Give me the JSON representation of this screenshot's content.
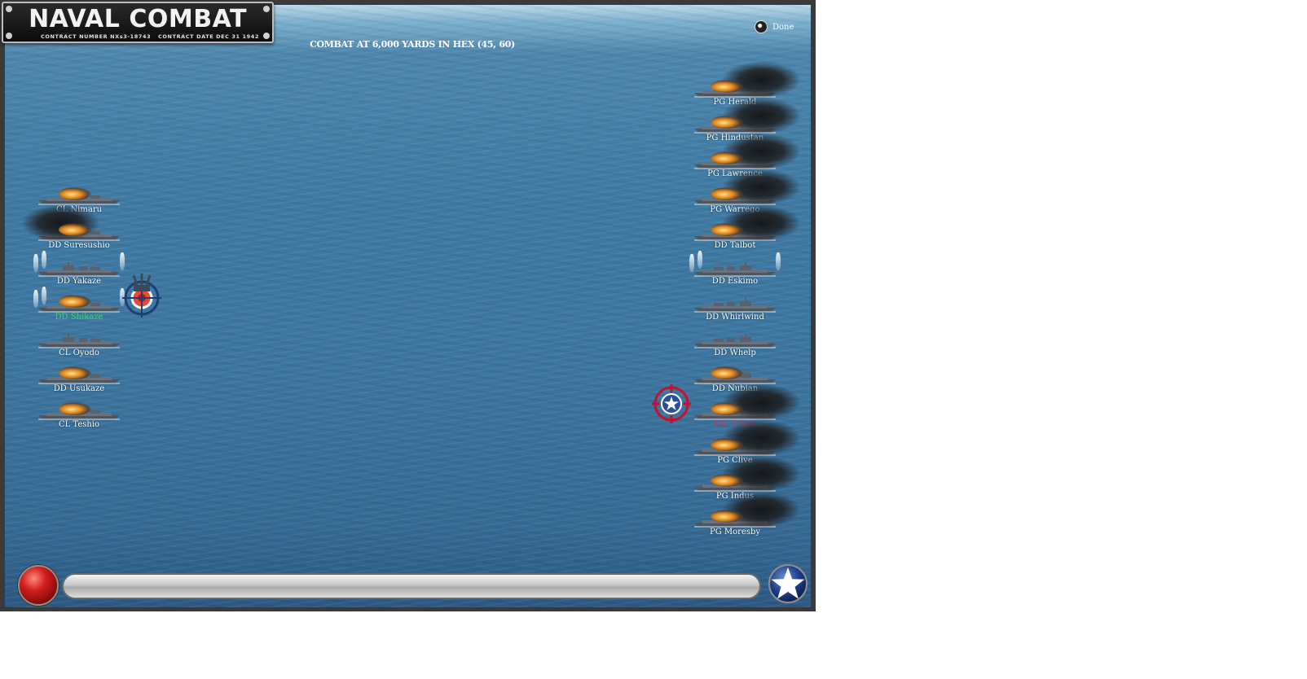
{
  "header": {
    "title": "NAVAL COMBAT",
    "contract_number": "CONTRACT NUMBER   NXs3-18743",
    "contract_date": "CONTRACT DATE DEC 31 1942"
  },
  "combat_heading": "COMBAT AT 6,000 YARDS IN HEX (45, 60)",
  "done_label": "Done",
  "japanese_fleet": [
    {
      "id": "nimaru",
      "name": "CL Nimaru",
      "damage": "fire"
    },
    {
      "id": "suresushio",
      "name": "DD Suresushio",
      "damage": "fire-smoke"
    },
    {
      "id": "yakaze",
      "name": "DD Yakaze",
      "damage": "splash"
    },
    {
      "id": "selected",
      "name": "DD Shikaze",
      "damage": "fire-splash",
      "state": "selected"
    },
    {
      "id": "oyodo",
      "name": "CL Oyodo",
      "damage": "none"
    },
    {
      "id": "usukaze",
      "name": "DD Usukaze",
      "damage": "fire"
    },
    {
      "id": "teshio",
      "name": "CL Teshio",
      "damage": "fire"
    }
  ],
  "allied_fleet": [
    {
      "id": "herald",
      "name": "PG Herald",
      "damage": "fire-smoke"
    },
    {
      "id": "hindustan",
      "name": "PG Hindustan",
      "damage": "fire-smoke"
    },
    {
      "id": "lawrence",
      "name": "PG Lawrence",
      "damage": "fire-smoke"
    },
    {
      "id": "warrego",
      "name": "PG Warrego",
      "damage": "fire-smoke"
    },
    {
      "id": "talbot",
      "name": "DD Talbot",
      "damage": "fire-smoke"
    },
    {
      "id": "eskimo",
      "name": "DD Eskimo",
      "damage": "splash"
    },
    {
      "id": "whirlwind",
      "name": "DD Whirlwind",
      "damage": "none"
    },
    {
      "id": "whelp",
      "name": "DD Whelp",
      "damage": "none"
    },
    {
      "id": "nubian",
      "name": "DD Nubian",
      "damage": "fire"
    },
    {
      "id": "target",
      "name": "DD Crane",
      "damage": "fire-smoke",
      "state": "targeted"
    },
    {
      "id": "clive",
      "name": "PG Clive",
      "damage": "fire-smoke"
    },
    {
      "id": "indus",
      "name": "PG Indus",
      "damage": "fire-smoke"
    },
    {
      "id": "moresby",
      "name": "PG Moresby",
      "damage": "fire-smoke"
    }
  ],
  "progress": 0,
  "colors": {
    "selected_name": "#2ee04a",
    "targeted_name": "#e8283a",
    "ship_label": "#ffffff"
  },
  "icons": {
    "japan_reticle": "crosshair-turret-icon",
    "allied_reticle": "crosshair-star-icon",
    "fire_button": "red-fire-button",
    "star_button": "allied-star-button"
  }
}
